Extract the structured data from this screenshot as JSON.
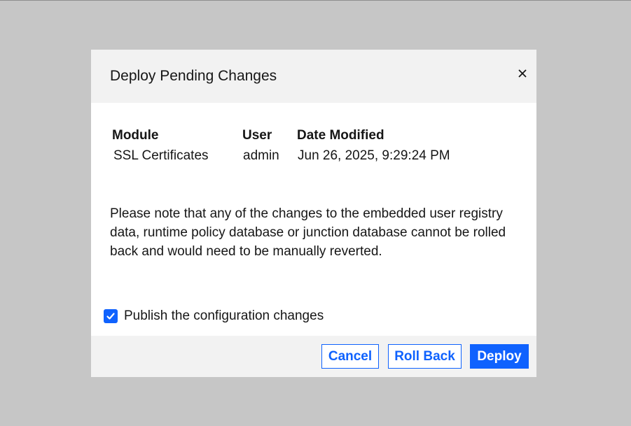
{
  "modal": {
    "title": "Deploy Pending Changes",
    "close_icon": "close-icon"
  },
  "table": {
    "headers": [
      "Module",
      "User",
      "Date Modified"
    ],
    "rows": [
      {
        "module": "SSL Certificates",
        "user": "admin",
        "date_modified": "Jun 26, 2025, 9:29:24 PM"
      }
    ]
  },
  "note": "Please note that any of the changes to the embedded user registry data, runtime policy database or junction database cannot be rolled back and would need to be manually reverted.",
  "publish": {
    "label": "Publish the configuration changes",
    "checked": true,
    "icon": "checkmark-icon"
  },
  "footer": {
    "cancel_label": "Cancel",
    "rollback_label": "Roll Back",
    "deploy_label": "Deploy"
  },
  "colors": {
    "overlay": "#c6c6c6",
    "header_bg": "#f2f2f2",
    "accent": "#0f62fe",
    "text": "#161616"
  }
}
